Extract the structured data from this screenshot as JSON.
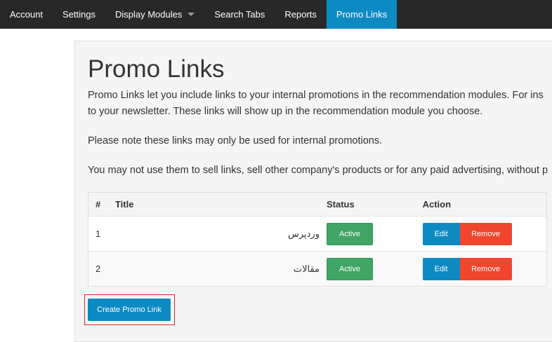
{
  "nav": {
    "items": [
      {
        "label": "Account"
      },
      {
        "label": "Settings"
      },
      {
        "label": "Display Modules"
      },
      {
        "label": "Search Tabs"
      },
      {
        "label": "Reports"
      },
      {
        "label": "Promo Links"
      }
    ],
    "active": "Promo Links"
  },
  "page": {
    "title": "Promo Links",
    "description_line1": "Promo Links let you include links to your internal promotions in the recommendation modules. For ins",
    "description_line2": "to your newsletter. These links will show up in the recommendation module you choose.",
    "note": "Please note these links may only be used for internal promotions.",
    "restriction": "You may not use them to sell links, sell other company's products or for any paid advertising, without p"
  },
  "table": {
    "headers": {
      "num": "#",
      "title": "Title",
      "status": "Status",
      "action": "Action"
    },
    "rows": [
      {
        "num": "1",
        "title": "وردپرس",
        "status": "Active",
        "edit": "Edit",
        "remove": "Remove"
      },
      {
        "num": "2",
        "title": "مقالات",
        "status": "Active",
        "edit": "Edit",
        "remove": "Remove"
      }
    ]
  },
  "create_button": "Create Promo Link",
  "colors": {
    "navbar_bg": "#282828",
    "nav_active_bg": "#0e8ac3",
    "status_green": "#40a565",
    "edit_blue": "#0e8ac3",
    "remove_red": "#f0462e",
    "highlight_red": "#d9242a"
  }
}
